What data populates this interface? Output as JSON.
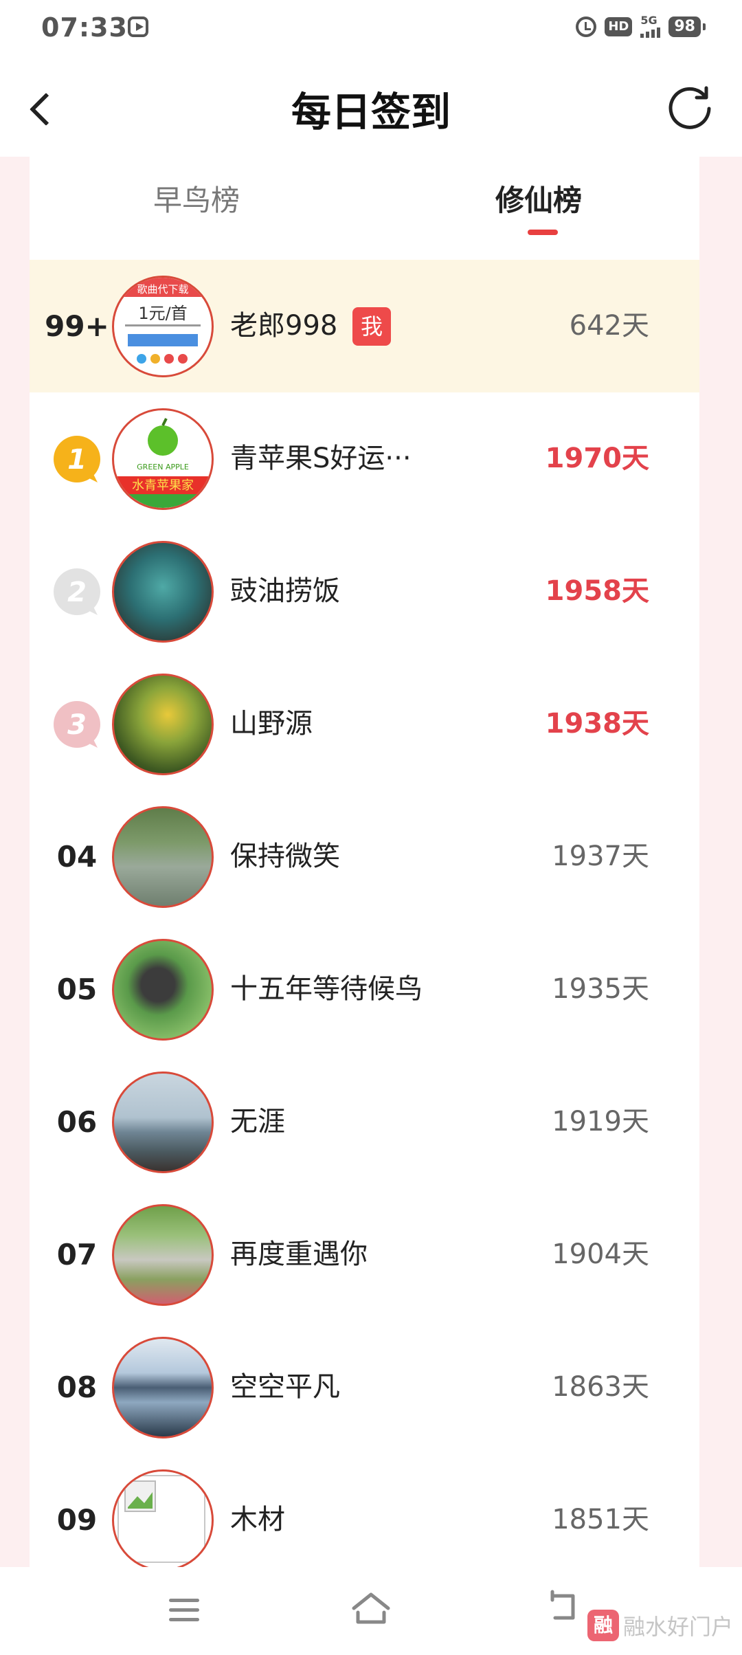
{
  "status": {
    "time": "07:33",
    "hd": "HD",
    "network": "5G",
    "battery": "98"
  },
  "header": {
    "title": "每日签到"
  },
  "tabs": [
    {
      "label": "早鸟榜",
      "active": false
    },
    {
      "label": "修仙榜",
      "active": true
    }
  ],
  "me": {
    "rank": "99+",
    "name": "老郎998",
    "badge": "我",
    "days": "642天",
    "avatar_text": {
      "line1": "歌曲代下载",
      "line2": "1元/首"
    }
  },
  "leaderboard": [
    {
      "rank": "1",
      "name": "青苹果S好运···",
      "days": "1970天",
      "avatar_text": {
        "brand": "GREEN APPLE",
        "line1": "水青苹果家"
      }
    },
    {
      "rank": "2",
      "name": "豉油捞饭",
      "days": "1958天"
    },
    {
      "rank": "3",
      "name": "山野源",
      "days": "1938天"
    },
    {
      "rank": "04",
      "name": "保持微笑",
      "days": "1937天"
    },
    {
      "rank": "05",
      "name": "十五年等待候鸟",
      "days": "1935天"
    },
    {
      "rank": "06",
      "name": "无涯",
      "days": "1919天"
    },
    {
      "rank": "07",
      "name": "再度重遇你",
      "days": "1904天"
    },
    {
      "rank": "08",
      "name": "空空平凡",
      "days": "1863天"
    },
    {
      "rank": "09",
      "name": "木材",
      "days": "1851天"
    }
  ],
  "watermark": {
    "logo": "融",
    "text": "融水好门户"
  },
  "colors": {
    "accent": "#e84040",
    "top_days": "#e3424b",
    "me_row": "#fdf6e3",
    "gold": "#f6b21a",
    "silver": "#d9d9d9",
    "bronze": "#eebcbf"
  }
}
